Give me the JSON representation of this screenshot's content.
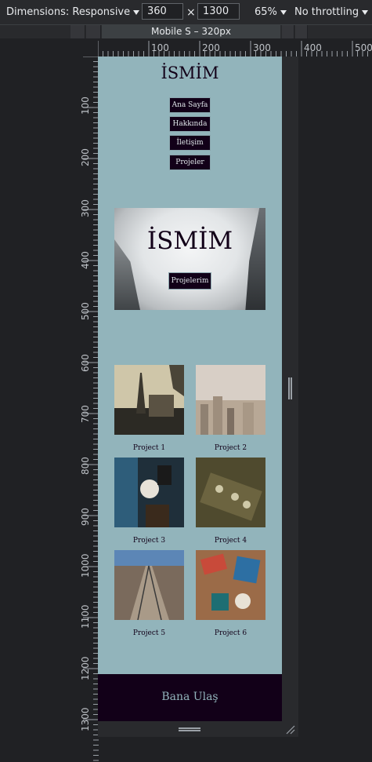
{
  "toolbar": {
    "dimensions_label": "Dimensions: Responsive",
    "width": "360",
    "times": "×",
    "height": "1300",
    "zoom": "65%",
    "throttling": "No throttling"
  },
  "media_query": {
    "label": "Mobile S – 320px"
  },
  "ruler_top": [
    "100",
    "200",
    "300",
    "400",
    "500"
  ],
  "ruler_left": [
    "100",
    "200",
    "300",
    "400",
    "500",
    "600",
    "700",
    "800",
    "900",
    "1000",
    "1100",
    "1200",
    "1300"
  ],
  "site": {
    "title": "İSMİM",
    "nav": [
      "Ana Sayfa",
      "Hakkında",
      "İletişim",
      "Projeler"
    ],
    "hero_title": "İSMİM",
    "hero_button": "Projelerim",
    "projects": [
      "Project 1",
      "Project 2",
      "Project 3",
      "Project 4",
      "Project 5",
      "Project 6"
    ],
    "footer": "Bana Ulaş"
  }
}
